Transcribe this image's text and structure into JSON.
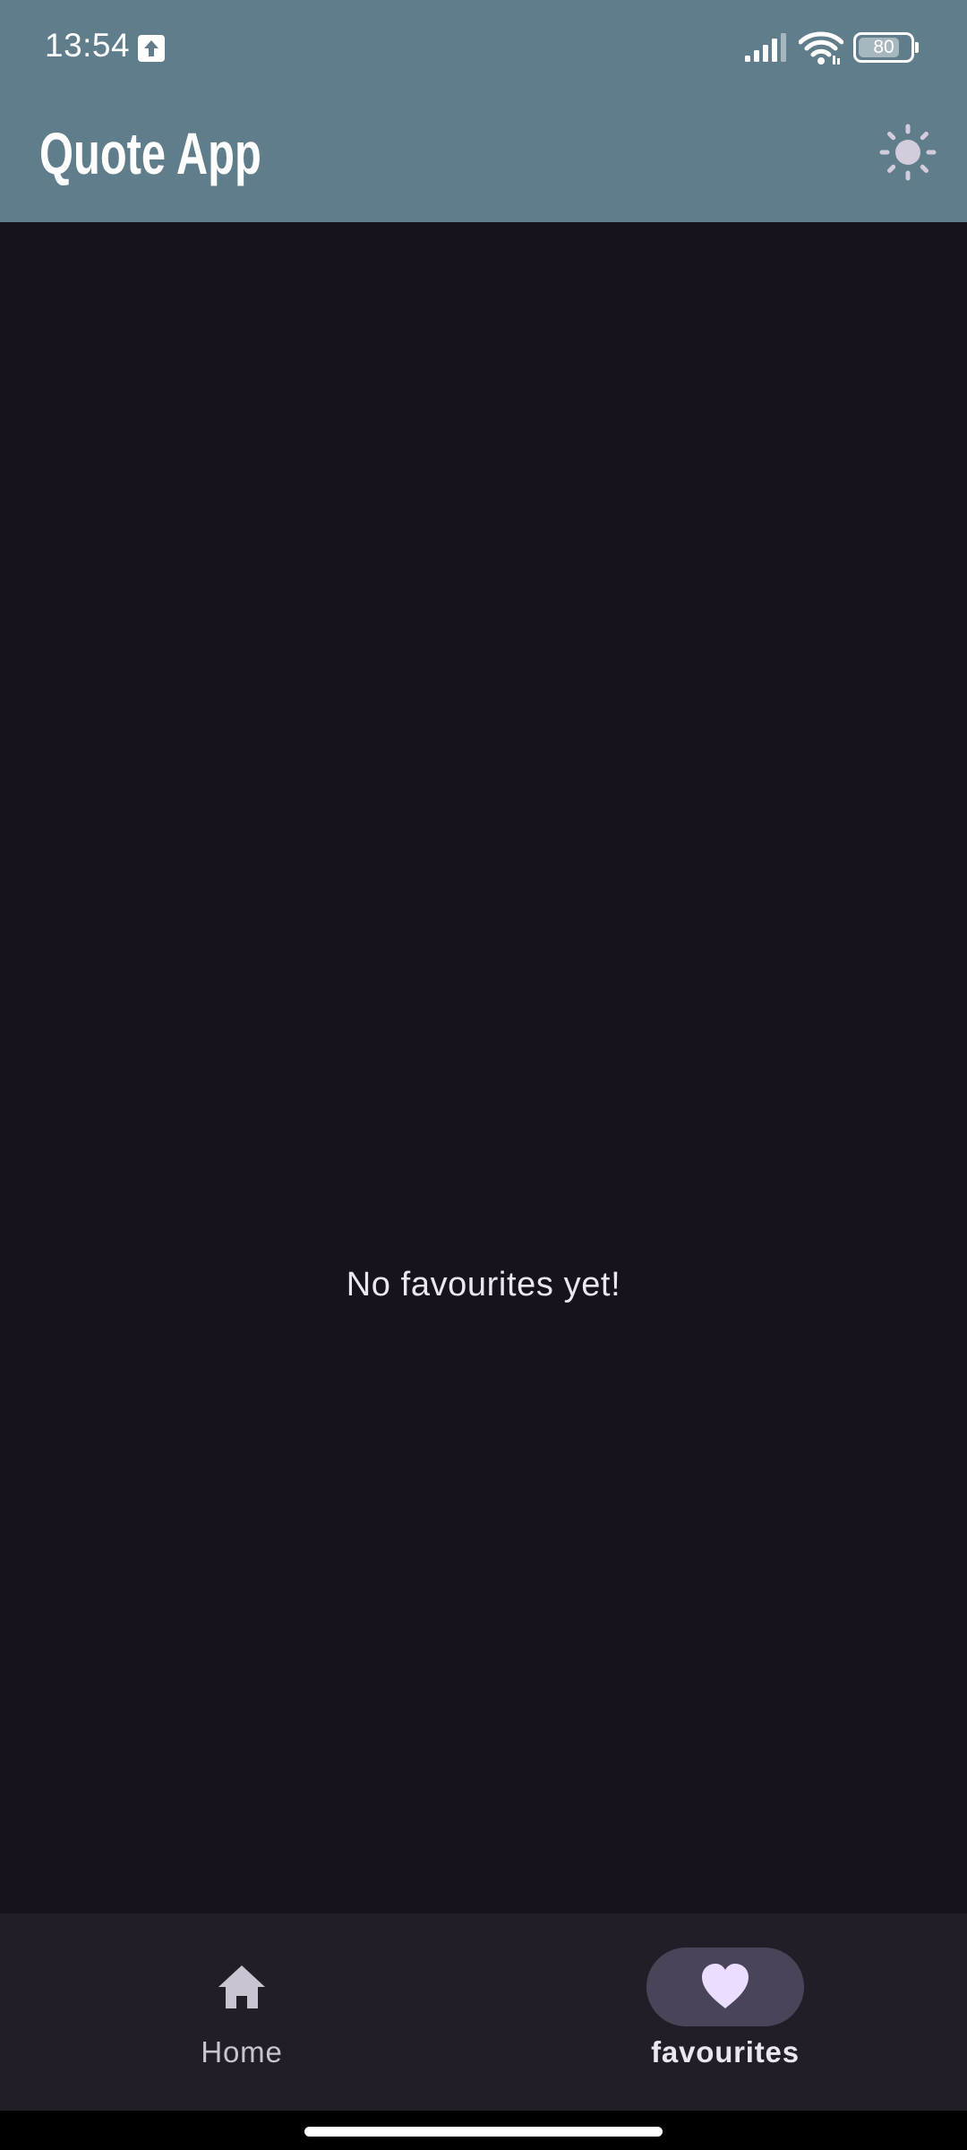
{
  "status_bar": {
    "time": "13:54",
    "battery_level": "80",
    "battery_fraction": 0.8
  },
  "app_bar": {
    "title": "Quote App",
    "theme_toggle_icon": "sun-icon"
  },
  "main": {
    "empty_message": "No favourites yet!"
  },
  "bottom_nav": {
    "items": [
      {
        "label": "Home",
        "icon": "home-icon",
        "selected": false
      },
      {
        "label": "favourites",
        "icon": "heart-icon",
        "selected": true
      }
    ]
  },
  "colors": {
    "app_bar": "#607d8b",
    "background": "#17121b",
    "nav_background": "#211e28",
    "nav_indicator": "#4a4458",
    "heart": "#eaddff",
    "sun": "#d3ccdc"
  }
}
